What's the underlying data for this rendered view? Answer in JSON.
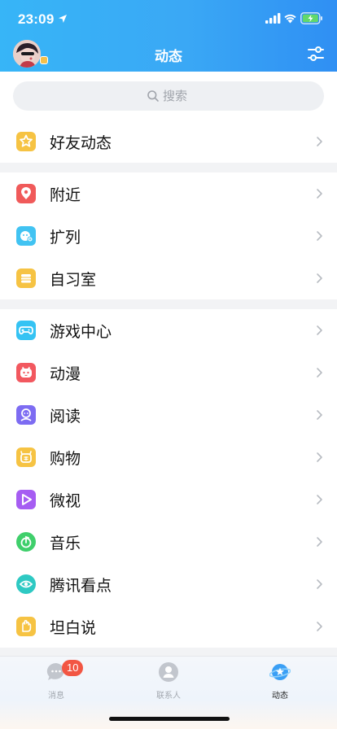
{
  "status_bar": {
    "time": "23:09"
  },
  "header": {
    "title": "动态"
  },
  "search": {
    "placeholder": "搜索"
  },
  "sections": [
    {
      "items": [
        {
          "label": "好友动态",
          "icon": "friends-star-icon",
          "color": "#f6c343"
        }
      ]
    },
    {
      "items": [
        {
          "label": "附近",
          "icon": "location-pin-icon",
          "color": "#f05a5a"
        },
        {
          "label": "扩列",
          "icon": "add-friend-icon",
          "color": "#41c3f2"
        },
        {
          "label": "自习室",
          "icon": "study-room-icon",
          "color": "#f6c343"
        }
      ]
    },
    {
      "items": [
        {
          "label": "游戏中心",
          "icon": "gamepad-icon",
          "color": "#35c3f3"
        },
        {
          "label": "动漫",
          "icon": "anime-icon",
          "color": "#f2585f"
        },
        {
          "label": "阅读",
          "icon": "reading-icon",
          "color": "#7d6cf2"
        },
        {
          "label": "购物",
          "icon": "shopping-icon",
          "color": "#f6c343"
        },
        {
          "label": "微视",
          "icon": "video-play-icon",
          "color": "#a65df2"
        },
        {
          "label": "音乐",
          "icon": "music-icon",
          "color": "#3fcf6b"
        },
        {
          "label": "腾讯看点",
          "icon": "eye-icon",
          "color": "#2ec9c3"
        },
        {
          "label": "坦白说",
          "icon": "hand-icon",
          "color": "#f6c343"
        }
      ]
    }
  ],
  "tabbar": {
    "tabs": [
      {
        "label": "消息",
        "badge": "10"
      },
      {
        "label": "联系人"
      },
      {
        "label": "动态"
      }
    ]
  }
}
